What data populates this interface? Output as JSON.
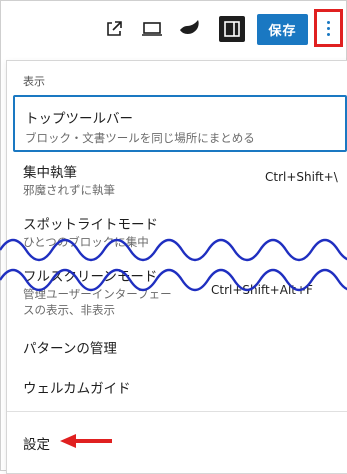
{
  "toolbar": {
    "icons": [
      "external-link-icon",
      "preview-desktop-icon",
      "style-halfmoon-icon",
      "sidebar-toggle-icon"
    ],
    "save_label": "保存",
    "more_icon": "more-vertical-icon",
    "colors": {
      "save_bg": "#1a78c2",
      "highlight": "#e02020"
    }
  },
  "menu": {
    "section_label": "表示",
    "items": [
      {
        "title": "トップツールバー",
        "desc": "ブロック・文書ツールを同じ場所にまとめる",
        "shortcut": ""
      },
      {
        "title": "集中執筆",
        "desc": "邪魔されずに執筆",
        "shortcut": "Ctrl+Shift+\\"
      },
      {
        "title": "スポットライトモード",
        "desc": "ひとつのブロックに集中",
        "shortcut": ""
      },
      {
        "title": "フルスクリーンモード",
        "desc": "管理ユーザーインターフェースの表示、非表示",
        "desc_line1": "管理ユーザーインターフェー",
        "desc_line2": "スの表示、非表示",
        "shortcut": "Ctrl+Shift+Alt+F"
      },
      {
        "title": "パターンの管理",
        "desc": "",
        "shortcut": ""
      },
      {
        "title": "ウェルカムガイド",
        "desc": "",
        "shortcut": ""
      },
      {
        "title": "設定",
        "desc": "",
        "shortcut": ""
      }
    ]
  }
}
